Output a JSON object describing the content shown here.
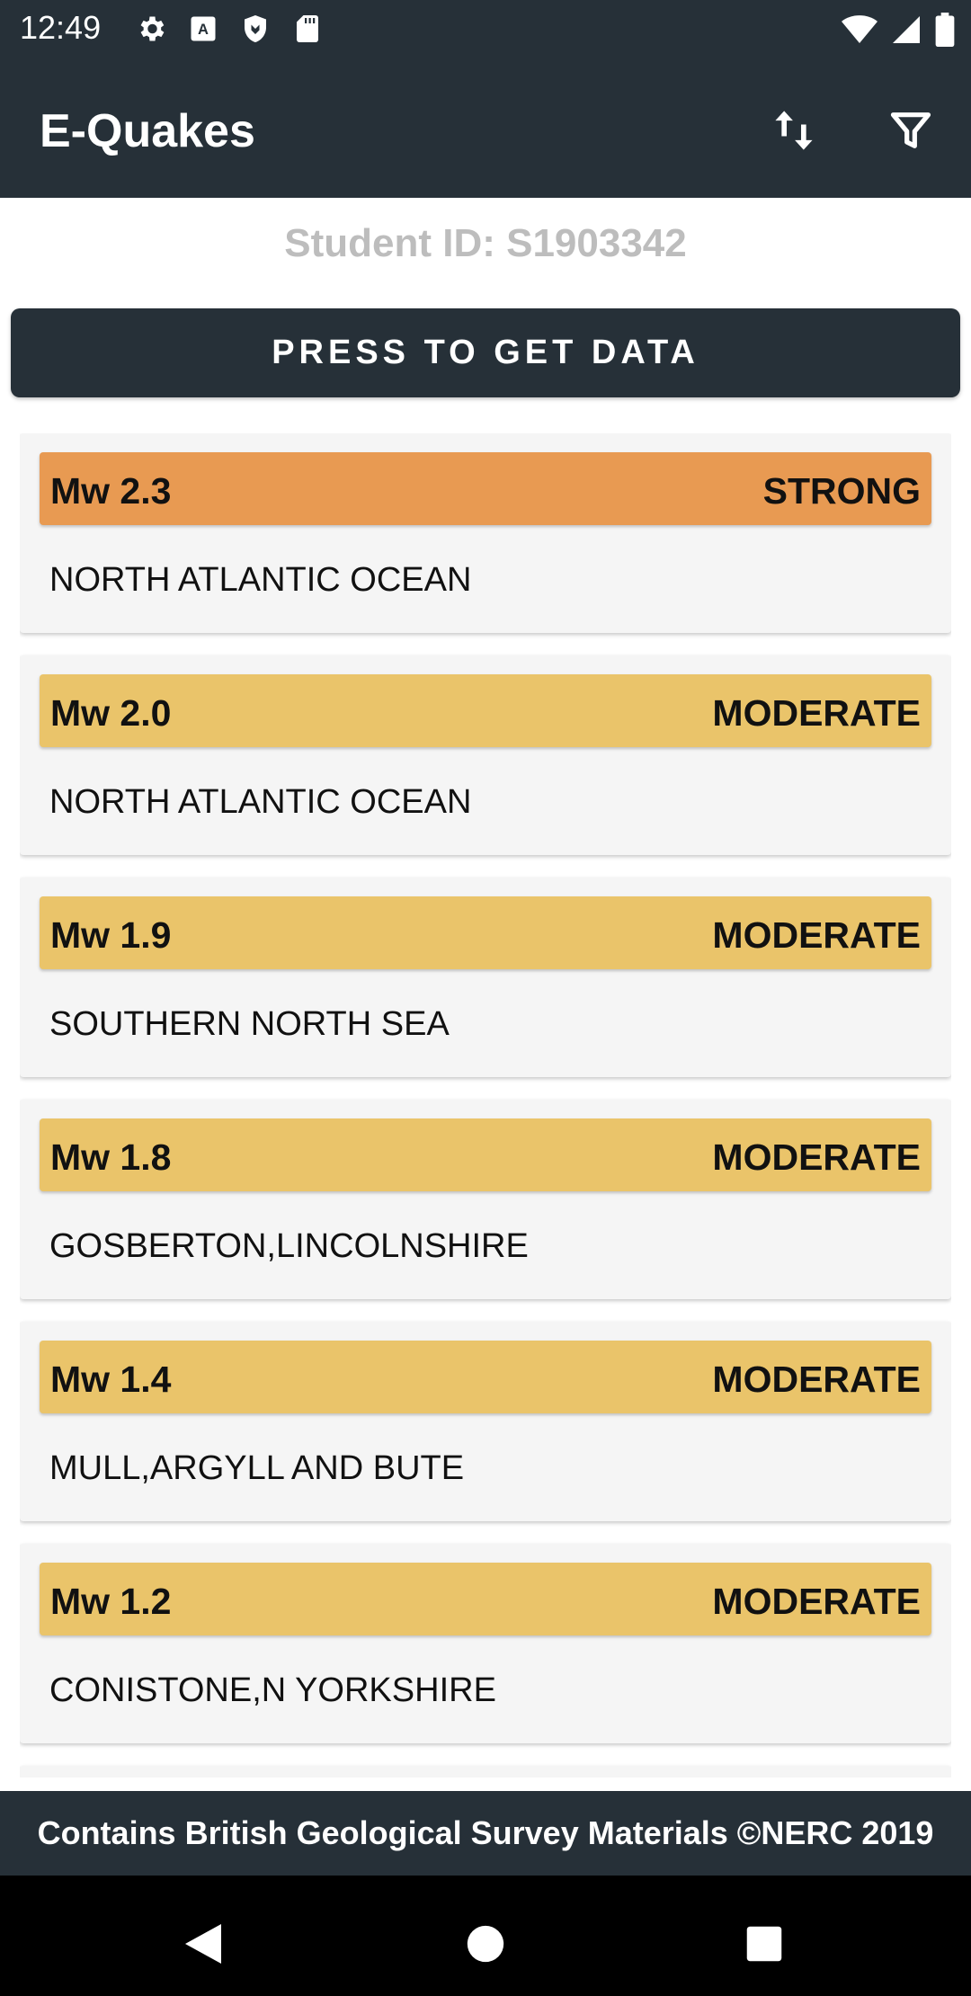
{
  "status_bar": {
    "time": "12:49",
    "left_icons": [
      "gear-icon",
      "keyboard-icon",
      "shield-icon",
      "sd-card-icon"
    ],
    "right_icons": [
      "wifi-icon",
      "signal-icon",
      "battery-icon"
    ]
  },
  "app_bar": {
    "title": "E-Quakes",
    "actions": [
      "sort-icon",
      "filter-icon"
    ]
  },
  "student_id": "Student ID: S1903342",
  "get_data_button": "PRESS TO GET DATA",
  "colors": {
    "primary_dark": "#263038",
    "strong": "#e89a52",
    "moderate": "#eac46a",
    "card_background": "#f5f5f5",
    "student_id_text": "#bdbdbd"
  },
  "quakes": [
    {
      "magnitude": "Mw 2.3",
      "strength": "STRONG",
      "location": "NORTH ATLANTIC OCEAN"
    },
    {
      "magnitude": "Mw 2.0",
      "strength": "MODERATE",
      "location": "NORTH ATLANTIC OCEAN"
    },
    {
      "magnitude": "Mw 1.9",
      "strength": "MODERATE",
      "location": "SOUTHERN NORTH SEA"
    },
    {
      "magnitude": "Mw 1.8",
      "strength": "MODERATE",
      "location": "GOSBERTON,LINCOLNSHIRE"
    },
    {
      "magnitude": "Mw 1.4",
      "strength": "MODERATE",
      "location": "MULL,ARGYLL AND BUTE"
    },
    {
      "magnitude": "Mw 1.2",
      "strength": "MODERATE",
      "location": "CONISTONE,N YORKSHIRE"
    }
  ],
  "footer": "Contains British Geological Survey Materials ©NERC 2019",
  "nav_bar": {
    "buttons": [
      "back-icon",
      "home-icon",
      "recents-icon"
    ]
  }
}
